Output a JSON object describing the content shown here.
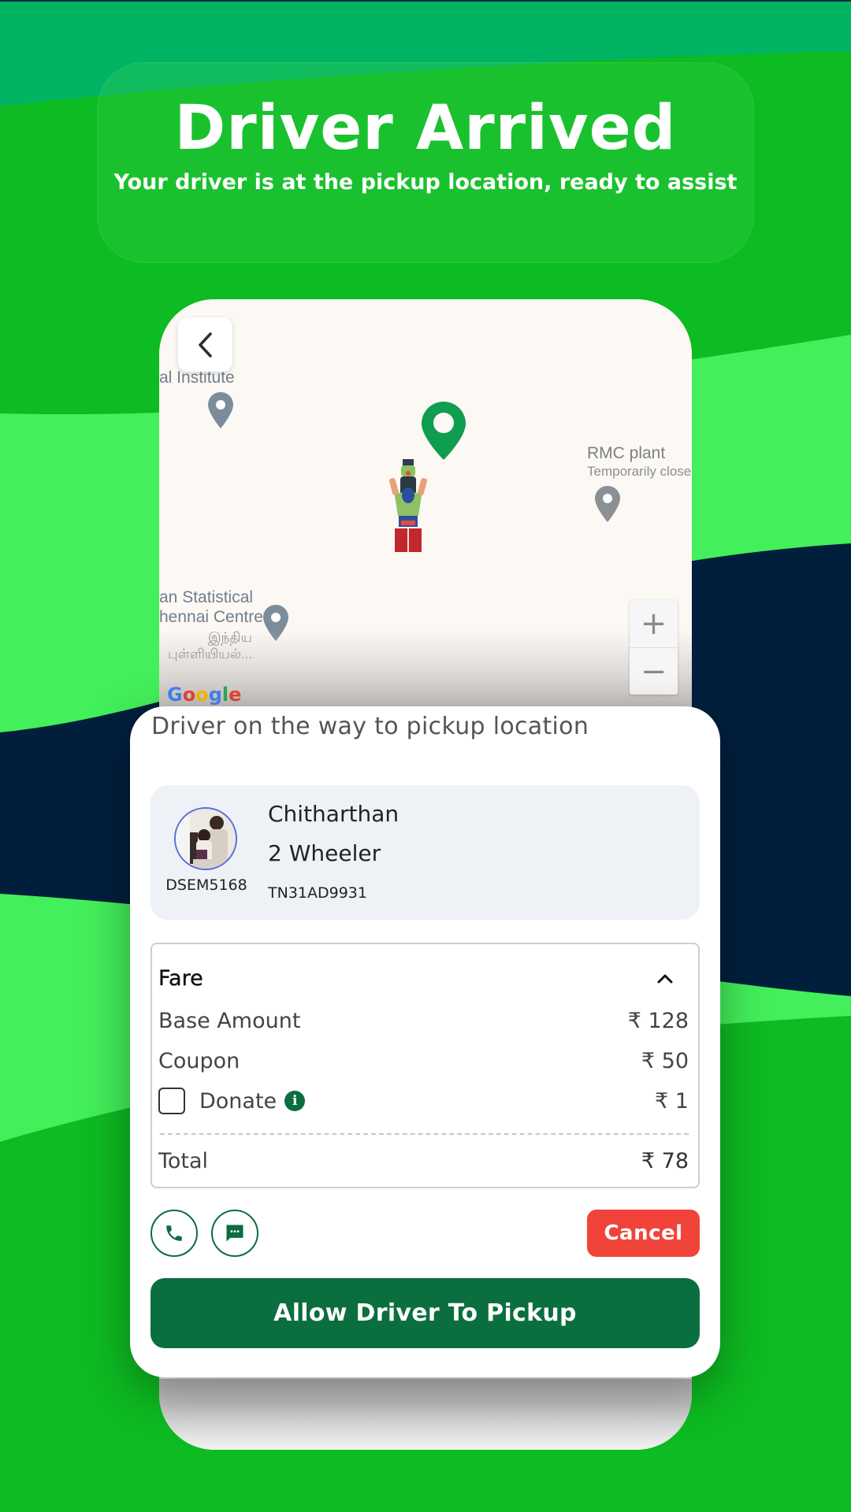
{
  "header": {
    "title": "Driver Arrived",
    "subtitle": "Your driver is at the pickup location, ready to assist"
  },
  "map": {
    "back_icon": "chevron-left-icon",
    "labels": {
      "institute": "al Institute",
      "rmc_name": "RMC plant",
      "rmc_status": "Temporarily close",
      "isi_line1": "an Statistical",
      "isi_line2": "hennai Centre",
      "isi_tamil1": "இந்திய",
      "isi_tamil2": "புள்ளியியல்..."
    },
    "zoom_in_label": "+",
    "zoom_out_label": "−",
    "attribution": "Google"
  },
  "sheet": {
    "status_text": "Driver on the way to pickup location",
    "driver": {
      "id": "DSEM5168",
      "name": "Chitharthan",
      "vehicle_type": "2 Wheeler",
      "plate": "TN31AD9931"
    },
    "fare": {
      "heading": "Fare",
      "rows": [
        {
          "label": "Base Amount",
          "amount": "₹ 128"
        },
        {
          "label": "Coupon",
          "amount": "₹ 50"
        }
      ],
      "donate": {
        "label": "Donate",
        "amount": "₹ 1",
        "checked": false,
        "info_icon": "i"
      },
      "total": {
        "label": "Total",
        "amount": "₹ 78"
      }
    },
    "actions": {
      "call_icon": "phone-icon",
      "chat_icon": "message-icon",
      "cancel_label": "Cancel",
      "primary_label": "Allow Driver To Pickup"
    }
  },
  "colors": {
    "brand_green": "#0b6e3e",
    "cancel_red": "#f0443a",
    "bg_green": "#0dbb22",
    "bg_light_green": "#43ef5a",
    "bg_navy": "#001f3d",
    "bg_teal": "#00b464"
  }
}
